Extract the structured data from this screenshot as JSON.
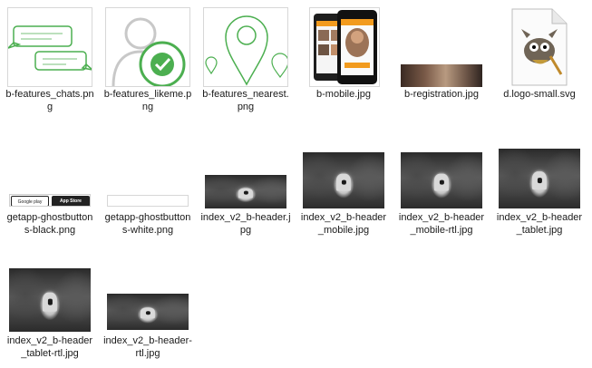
{
  "files": [
    {
      "name": "b-features_chats.png",
      "kind": "chats-icon"
    },
    {
      "name": "b-features_likeme.png",
      "kind": "likeme-icon"
    },
    {
      "name": "b-features_nearest.png",
      "kind": "nearest-icon"
    },
    {
      "name": "b-mobile.jpg",
      "kind": "mobile-photo"
    },
    {
      "name": "b-registration.jpg",
      "kind": "banner-photo"
    },
    {
      "name": "d.logo-small.svg",
      "kind": "svg-document-icon"
    },
    {
      "name": "getapp-ghostbuttons-black.png",
      "kind": "store-buttons"
    },
    {
      "name": "getapp-ghostbuttons-white.png",
      "kind": "white-strip"
    },
    {
      "name": "index_v2_b-header.jpg",
      "kind": "header-photo"
    },
    {
      "name": "index_v2_b-header_mobile.jpg",
      "kind": "header-photo"
    },
    {
      "name": "index_v2_b-header_mobile-rtl.jpg",
      "kind": "header-photo"
    },
    {
      "name": "index_v2_b-header_tablet.jpg",
      "kind": "header-photo"
    },
    {
      "name": "index_v2_b-header_tablet-rtl.jpg",
      "kind": "header-photo"
    },
    {
      "name": "index_v2_b-header-rtl.jpg",
      "kind": "header-photo"
    }
  ],
  "store_buttons": {
    "google_play": "Google play",
    "app_store_small": "Download on the",
    "app_store": "App Store"
  },
  "colors": {
    "accent_green": "#4caf50",
    "selection": "#e5f3ff",
    "thumb_border": "#d7d7d7"
  }
}
